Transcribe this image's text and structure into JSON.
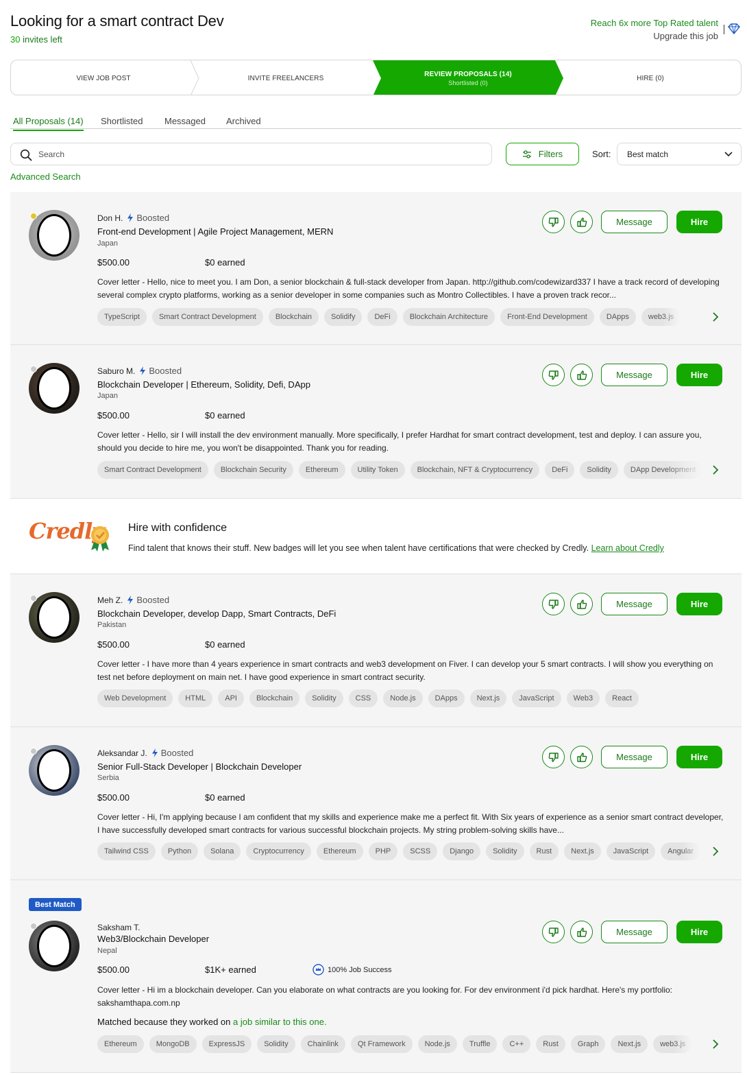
{
  "header": {
    "job_title": "Looking for a smart contract Dev",
    "invites_count": "30",
    "invites_label": "invites left",
    "upsell_line1": "Reach 6x more Top Rated talent",
    "upsell_line2": "Upgrade this job",
    "upsell_icon": "diamond-icon"
  },
  "steps": [
    {
      "label": "VIEW JOB POST",
      "sub": ""
    },
    {
      "label": "INVITE FREELANCERS",
      "sub": ""
    },
    {
      "label": "REVIEW PROPOSALS (14)",
      "sub": "Shortlisted (0)"
    },
    {
      "label": "HIRE (0)",
      "sub": ""
    }
  ],
  "tabs": [
    "All Proposals (14)",
    "Shortlisted",
    "Messaged",
    "Archived"
  ],
  "search": {
    "placeholder": "Search"
  },
  "filters_label": "Filters",
  "sort": {
    "label": "Sort:",
    "value": "Best match"
  },
  "advanced_search": "Advanced Search",
  "boosted_label": "Boosted",
  "action_labels": {
    "message": "Message",
    "hire": "Hire"
  },
  "colors": {
    "brand_green": "#14a800",
    "text_green": "#1a7a1a",
    "best_match_blue": "#1f5ac5",
    "credly_orange": "#e66a2c"
  },
  "proposals": [
    {
      "name": "Don H.",
      "boosted": true,
      "title": "Front-end Development | Agile Project Management, MERN",
      "location": "Japan",
      "rate": "$500.00",
      "earned": "$0 earned",
      "cover_letter": "Cover letter - Hello, nice to meet you. I am Don, a senior blockchain & full-stack developer from Japan. http://github.com/codewizard337 I have a track record of developing several complex crypto platforms, working as a senior developer in some companies such as Montro Collectibles. I have a proven track recor...",
      "skills": [
        "TypeScript",
        "Smart Contract Development",
        "Blockchain",
        "Solidify",
        "DeFi",
        "Blockchain Architecture",
        "Front-End Development",
        "DApps",
        "web3.js"
      ],
      "status": "online"
    },
    {
      "name": "Saburo M.",
      "boosted": true,
      "title": "Blockchain Developer | Ethereum, Solidity, Defi, DApp",
      "location": "Japan",
      "rate": "$500.00",
      "earned": "$0 earned",
      "cover_letter": "Cover letter - Hello, sir I will install the dev environment manually. More specifically, I prefer Hardhat for smart contract development, test and deploy. I can assure you, should you decide to hire me, you won't be disappointed. Thank you for reading.",
      "skills": [
        "Smart Contract Development",
        "Blockchain Security",
        "Ethereum",
        "Utility Token",
        "Blockchain, NFT & Cryptocurrency",
        "DeFi",
        "Solidity",
        "DApp Development"
      ],
      "status": "offline"
    },
    {
      "name": "Meh Z.",
      "boosted": true,
      "title": "Blockchain Developer, develop Dapp, Smart Contracts, DeFi",
      "location": "Pakistan",
      "rate": "$500.00",
      "earned": "$0 earned",
      "cover_letter": "Cover letter - I have more than 4 years experience in smart contracts and web3 development on Fiver. I can develop your 5 smart contracts. I will show you everything on test net before deployment on main net. I have good experience in smart contract security.",
      "skills": [
        "Web Development",
        "HTML",
        "API",
        "Blockchain",
        "Solidity",
        "CSS",
        "Node.js",
        "DApps",
        "Next.js",
        "JavaScript",
        "Web3",
        "React"
      ],
      "status": "offline"
    },
    {
      "name": "Aleksandar J.",
      "boosted": true,
      "title": "Senior Full-Stack Developer | Blockchain Developer",
      "location": "Serbia",
      "rate": "$500.00",
      "earned": "$0 earned",
      "cover_letter": "Cover letter - Hi, I'm applying because I am confident that my skills and experience make me a perfect fit. With Six years of experience as a senior smart contract developer, I have successfully developed smart contracts for various successful blockchain projects. My string problem-solving skills have...",
      "skills": [
        "Tailwind CSS",
        "Python",
        "Solana",
        "Cryptocurrency",
        "Ethereum",
        "PHP",
        "SCSS",
        "Django",
        "Solidity",
        "Rust",
        "Next.js",
        "JavaScript",
        "Angular"
      ],
      "status": "offline"
    },
    {
      "badge": "Best Match",
      "name": "Saksham T.",
      "boosted": false,
      "title": "Web3/Blockchain Developer",
      "location": "Nepal",
      "rate": "$500.00",
      "earned": "$1K+ earned",
      "job_success": "100% Job Success",
      "cover_letter": "Cover letter - Hi im a blockchain developer. Can you elaborate on what contracts are you looking for. For dev environment i'd pick hardhat. Here's my portfolio: sakshamthapa.com.np",
      "matched_prefix": "Matched because they worked on",
      "matched_link": "a job similar to this one.",
      "skills": [
        "Ethereum",
        "MongoDB",
        "ExpressJS",
        "Solidity",
        "Chainlink",
        "Qt Framework",
        "Node.js",
        "Truffle",
        "C++",
        "Rust",
        "Graph",
        "Next.js",
        "web3.js"
      ],
      "status": "offline"
    }
  ],
  "credly": {
    "logo_text": "Credly",
    "heading": "Hire with confidence",
    "text": "Find talent that knows their stuff. New badges will let you see when talent have certifications that were checked by Credly.",
    "link": "Learn about Credly"
  }
}
